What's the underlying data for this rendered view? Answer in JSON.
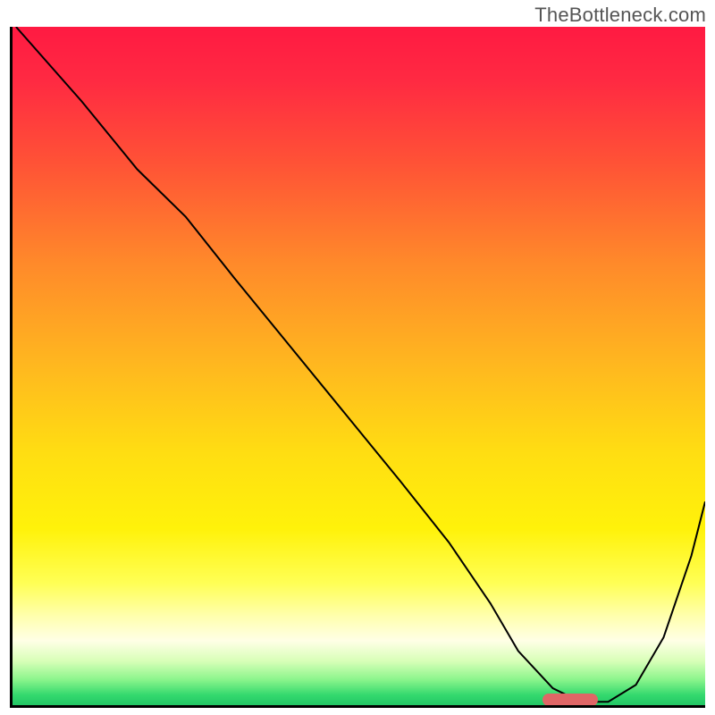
{
  "watermark": "TheBottleneck.com",
  "chart_data": {
    "type": "line",
    "title": "",
    "xlabel": "",
    "ylabel": "",
    "xlim": [
      0,
      100
    ],
    "ylim": [
      0,
      100
    ],
    "grid": false,
    "background": {
      "type": "vertical-gradient",
      "stops": [
        {
          "offset": 0.0,
          "color": "#ff1a42"
        },
        {
          "offset": 0.08,
          "color": "#ff2a42"
        },
        {
          "offset": 0.2,
          "color": "#ff5236"
        },
        {
          "offset": 0.35,
          "color": "#ff8a2a"
        },
        {
          "offset": 0.5,
          "color": "#ffb81f"
        },
        {
          "offset": 0.63,
          "color": "#ffde12"
        },
        {
          "offset": 0.74,
          "color": "#fff20a"
        },
        {
          "offset": 0.82,
          "color": "#ffff55"
        },
        {
          "offset": 0.87,
          "color": "#ffffb0"
        },
        {
          "offset": 0.905,
          "color": "#ffffe6"
        },
        {
          "offset": 0.935,
          "color": "#d8ffb8"
        },
        {
          "offset": 0.962,
          "color": "#8cf58c"
        },
        {
          "offset": 0.985,
          "color": "#34d96e"
        },
        {
          "offset": 1.0,
          "color": "#22c765"
        }
      ]
    },
    "series": [
      {
        "name": "bottleneck-curve",
        "stroke": "#000000",
        "stroke_width": 2,
        "x": [
          0.5,
          10,
          18,
          25,
          32,
          40,
          48,
          56,
          63,
          69,
          73,
          78,
          82,
          86,
          90,
          94,
          98,
          100
        ],
        "y": [
          100,
          89,
          79,
          72,
          63,
          53,
          43,
          33,
          24,
          15,
          8,
          2.5,
          0.5,
          0.5,
          3,
          10,
          22,
          30
        ]
      }
    ],
    "marker": {
      "color": "#e06666",
      "x_start": 76.5,
      "x_end": 84.5,
      "y": 0.8
    }
  }
}
